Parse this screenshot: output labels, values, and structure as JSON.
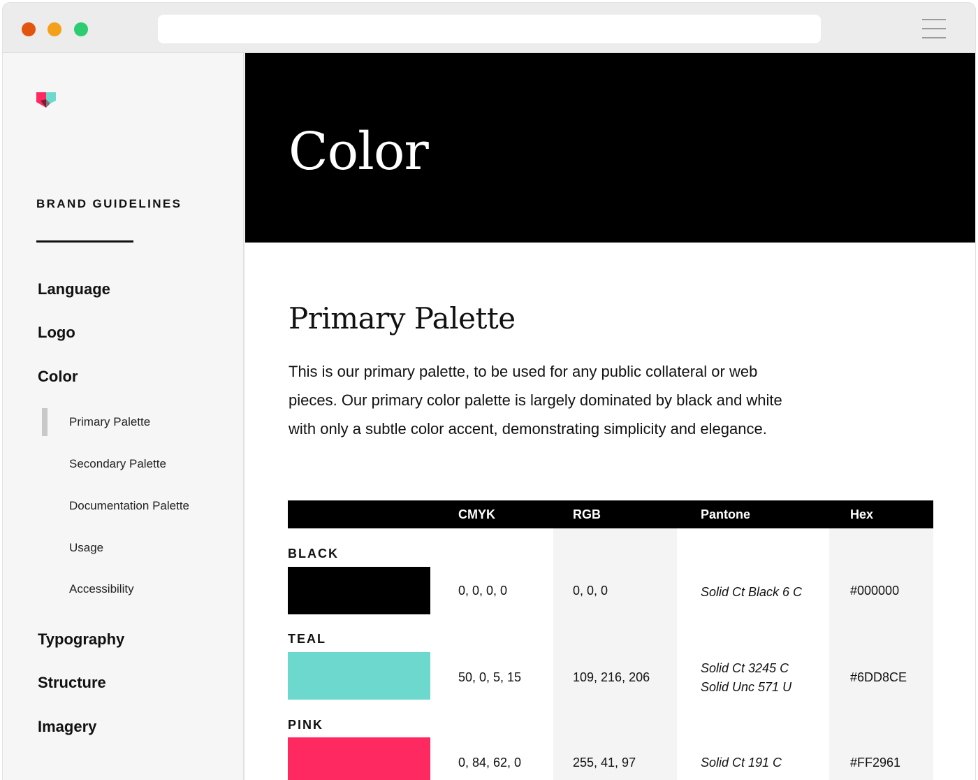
{
  "window": {
    "traffic_lights": {
      "close": "#e2550e",
      "minimize": "#f4a01a",
      "zoom": "#2ecc71"
    },
    "url": ""
  },
  "sidebar": {
    "brand_title": "BRAND GUIDELINES",
    "logo_colors": {
      "pink": "#FF2961",
      "teal": "#6DD8CE",
      "dark": "#111111"
    },
    "nav": [
      {
        "label": "Language"
      },
      {
        "label": "Logo"
      },
      {
        "label": "Color"
      },
      {
        "label": "Typography"
      },
      {
        "label": "Structure"
      },
      {
        "label": "Imagery"
      }
    ],
    "color_subnav": [
      {
        "label": "Primary Palette",
        "active": true
      },
      {
        "label": "Secondary Palette",
        "active": false
      },
      {
        "label": "Documentation Palette",
        "active": false
      },
      {
        "label": "Usage",
        "active": false
      },
      {
        "label": "Accessibility",
        "active": false
      }
    ]
  },
  "hero": {
    "title": "Color"
  },
  "main": {
    "section_title": "Primary Palette",
    "section_desc_lines": [
      "This is our primary palette, to be used for any public collateral or web",
      "pieces. Our primary color palette is largely dominated by black and white",
      "with only a subtle color accent, demonstrating simplicity and elegance."
    ],
    "table": {
      "headers": {
        "cmyk": "CMYK",
        "rgb": "RGB",
        "pantone": "Pantone",
        "hex": "Hex"
      },
      "rows": [
        {
          "name": "BLACK",
          "swatch": "#000000",
          "cmyk": "0, 0, 0, 0",
          "rgb": "0, 0, 0",
          "pantone": [
            "Solid Ct Black 6 C"
          ],
          "hex": "#000000"
        },
        {
          "name": "TEAL",
          "swatch": "#6DD8CE",
          "cmyk": "50, 0, 5, 15",
          "rgb": "109, 216, 206",
          "pantone": [
            "Solid Ct 3245 C",
            "Solid Unc 571 U"
          ],
          "hex": "#6DD8CE"
        },
        {
          "name": "PINK",
          "swatch": "#FF2961",
          "cmyk": "0, 84, 62, 0",
          "rgb": "255, 41, 97",
          "pantone": [
            "Solid Ct 191 C"
          ],
          "hex": "#FF2961"
        }
      ]
    }
  }
}
